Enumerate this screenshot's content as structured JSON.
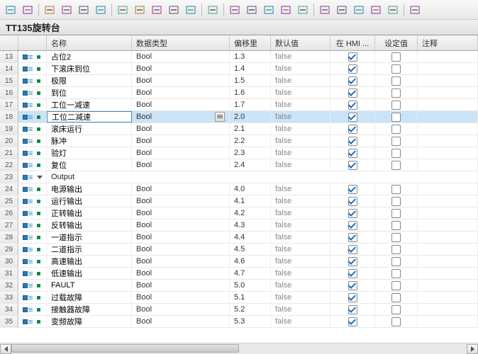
{
  "title": "TT135旋转台",
  "headers": {
    "name": "名称",
    "dtype": "数据类型",
    "offset": "偏移里",
    "default": "默认值",
    "hmi": "在 HMI ...",
    "set": "设定值",
    "comment": "注释"
  },
  "rows": [
    {
      "rn": "13",
      "kind": "var",
      "sel": false,
      "name": "占位2",
      "dtype": "Bool",
      "offset": "1.3",
      "default": "false",
      "hmi": true,
      "set": false,
      "dd": false
    },
    {
      "rn": "14",
      "kind": "var",
      "sel": false,
      "name": "下滚床到位",
      "dtype": "Bool",
      "offset": "1.4",
      "default": "false",
      "hmi": true,
      "set": false,
      "dd": false
    },
    {
      "rn": "15",
      "kind": "var",
      "sel": false,
      "name": "极限",
      "dtype": "Bool",
      "offset": "1.5",
      "default": "false",
      "hmi": true,
      "set": false,
      "dd": false
    },
    {
      "rn": "16",
      "kind": "var",
      "sel": false,
      "name": "到位",
      "dtype": "Bool",
      "offset": "1.6",
      "default": "false",
      "hmi": true,
      "set": false,
      "dd": false
    },
    {
      "rn": "17",
      "kind": "var",
      "sel": false,
      "name": "工位一减速",
      "dtype": "Bool",
      "offset": "1.7",
      "default": "false",
      "hmi": true,
      "set": false,
      "dd": false
    },
    {
      "rn": "18",
      "kind": "var",
      "sel": true,
      "name": "工位二减速",
      "dtype": "Bool",
      "offset": "2.0",
      "default": "false",
      "hmi": true,
      "set": false,
      "dd": true
    },
    {
      "rn": "19",
      "kind": "var",
      "sel": false,
      "name": "滚床运行",
      "dtype": "Bool",
      "offset": "2.1",
      "default": "false",
      "hmi": true,
      "set": false,
      "dd": false
    },
    {
      "rn": "20",
      "kind": "var",
      "sel": false,
      "name": "脉冲",
      "dtype": "Bool",
      "offset": "2.2",
      "default": "false",
      "hmi": true,
      "set": false,
      "dd": false
    },
    {
      "rn": "21",
      "kind": "var",
      "sel": false,
      "name": "验灯",
      "dtype": "Bool",
      "offset": "2.3",
      "default": "false",
      "hmi": true,
      "set": false,
      "dd": false
    },
    {
      "rn": "22",
      "kind": "var",
      "sel": false,
      "name": "复位",
      "dtype": "Bool",
      "offset": "2.4",
      "default": "false",
      "hmi": true,
      "set": false,
      "dd": false
    },
    {
      "rn": "23",
      "kind": "struct",
      "sel": false,
      "name": "Output"
    },
    {
      "rn": "24",
      "kind": "var",
      "sel": false,
      "name": "电源输出",
      "dtype": "Bool",
      "offset": "4.0",
      "default": "false",
      "hmi": true,
      "set": false,
      "dd": false
    },
    {
      "rn": "25",
      "kind": "var",
      "sel": false,
      "name": "运行输出",
      "dtype": "Bool",
      "offset": "4.1",
      "default": "false",
      "hmi": true,
      "set": false,
      "dd": false
    },
    {
      "rn": "26",
      "kind": "var",
      "sel": false,
      "name": "正转输出",
      "dtype": "Bool",
      "offset": "4.2",
      "default": "false",
      "hmi": true,
      "set": false,
      "dd": false
    },
    {
      "rn": "27",
      "kind": "var",
      "sel": false,
      "name": "反转输出",
      "dtype": "Bool",
      "offset": "4.3",
      "default": "false",
      "hmi": true,
      "set": false,
      "dd": false
    },
    {
      "rn": "28",
      "kind": "var",
      "sel": false,
      "name": "一道指示",
      "dtype": "Bool",
      "offset": "4.4",
      "default": "false",
      "hmi": true,
      "set": false,
      "dd": false
    },
    {
      "rn": "29",
      "kind": "var",
      "sel": false,
      "name": "二道指示",
      "dtype": "Bool",
      "offset": "4.5",
      "default": "false",
      "hmi": true,
      "set": false,
      "dd": false
    },
    {
      "rn": "30",
      "kind": "var",
      "sel": false,
      "name": "高速输出",
      "dtype": "Bool",
      "offset": "4.6",
      "default": "false",
      "hmi": true,
      "set": false,
      "dd": false
    },
    {
      "rn": "31",
      "kind": "var",
      "sel": false,
      "name": "低速输出",
      "dtype": "Bool",
      "offset": "4.7",
      "default": "false",
      "hmi": true,
      "set": false,
      "dd": false
    },
    {
      "rn": "32",
      "kind": "var",
      "sel": false,
      "name": "FAULT",
      "dtype": "Bool",
      "offset": "5.0",
      "default": "false",
      "hmi": true,
      "set": false,
      "dd": false
    },
    {
      "rn": "33",
      "kind": "var",
      "sel": false,
      "name": "过载故障",
      "dtype": "Bool",
      "offset": "5.1",
      "default": "false",
      "hmi": true,
      "set": false,
      "dd": false
    },
    {
      "rn": "34",
      "kind": "var",
      "sel": false,
      "name": "接触器故障",
      "dtype": "Bool",
      "offset": "5.2",
      "default": "false",
      "hmi": true,
      "set": false,
      "dd": false
    },
    {
      "rn": "35",
      "kind": "var",
      "sel": false,
      "name": "变频故障",
      "dtype": "Bool",
      "offset": "5.3",
      "default": "false",
      "hmi": true,
      "set": false,
      "dd": false
    }
  ],
  "toolbar_icons": [
    "insert-row-icon",
    "add-row-icon",
    "sep",
    "expand-icon",
    "collapse-icon",
    "list-icon",
    "comment-icon",
    "sep",
    "sort-asc-icon",
    "sort-desc-icon",
    "indent-icon",
    "outdent-icon",
    "protect-icon",
    "sep",
    "monitor-icon",
    "sep",
    "refresh-icon",
    "link-icon",
    "unlink-icon",
    "download-icon",
    "upload-icon",
    "sep",
    "tag-a-icon",
    "tag-b-icon",
    "filter-icon",
    "column-icon",
    "width-icon",
    "sep",
    "help-icon"
  ]
}
